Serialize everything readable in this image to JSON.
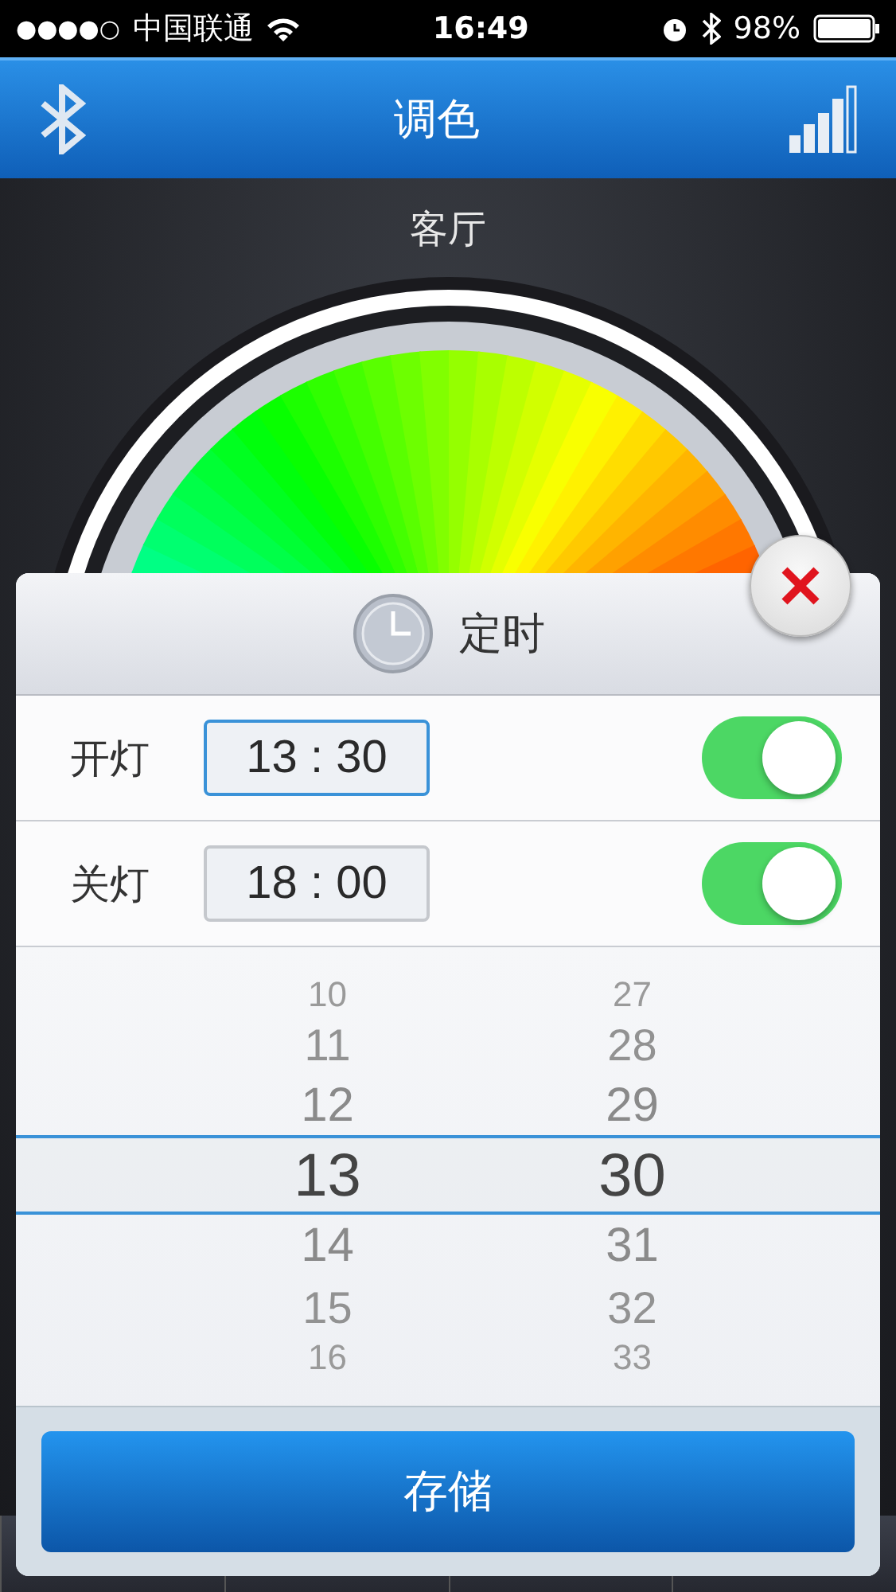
{
  "status_bar": {
    "signal_dots": "●●●●○",
    "carrier": "中国联通",
    "time": "16:49",
    "battery": "98%"
  },
  "header": {
    "title": "调色"
  },
  "room": "客厅",
  "dialog": {
    "title": "定时",
    "rows": [
      {
        "label": "开灯",
        "time": "13 : 30",
        "selected": true,
        "on": true
      },
      {
        "label": "关灯",
        "time": "18 : 00",
        "selected": false,
        "on": true
      }
    ],
    "picker": {
      "hours": [
        {
          "value": "10",
          "selected": false
        },
        {
          "value": "11",
          "selected": false
        },
        {
          "value": "12",
          "selected": false
        },
        {
          "value": "13",
          "selected": true
        },
        {
          "value": "14",
          "selected": false
        },
        {
          "value": "15",
          "selected": false
        },
        {
          "value": "16",
          "selected": false
        }
      ],
      "minutes": [
        {
          "value": "27",
          "selected": false
        },
        {
          "value": "28",
          "selected": false
        },
        {
          "value": "29",
          "selected": false
        },
        {
          "value": "30",
          "selected": true
        },
        {
          "value": "31",
          "selected": false
        },
        {
          "value": "32",
          "selected": false
        },
        {
          "value": "33",
          "selected": false
        }
      ]
    },
    "save_button": "存储"
  }
}
